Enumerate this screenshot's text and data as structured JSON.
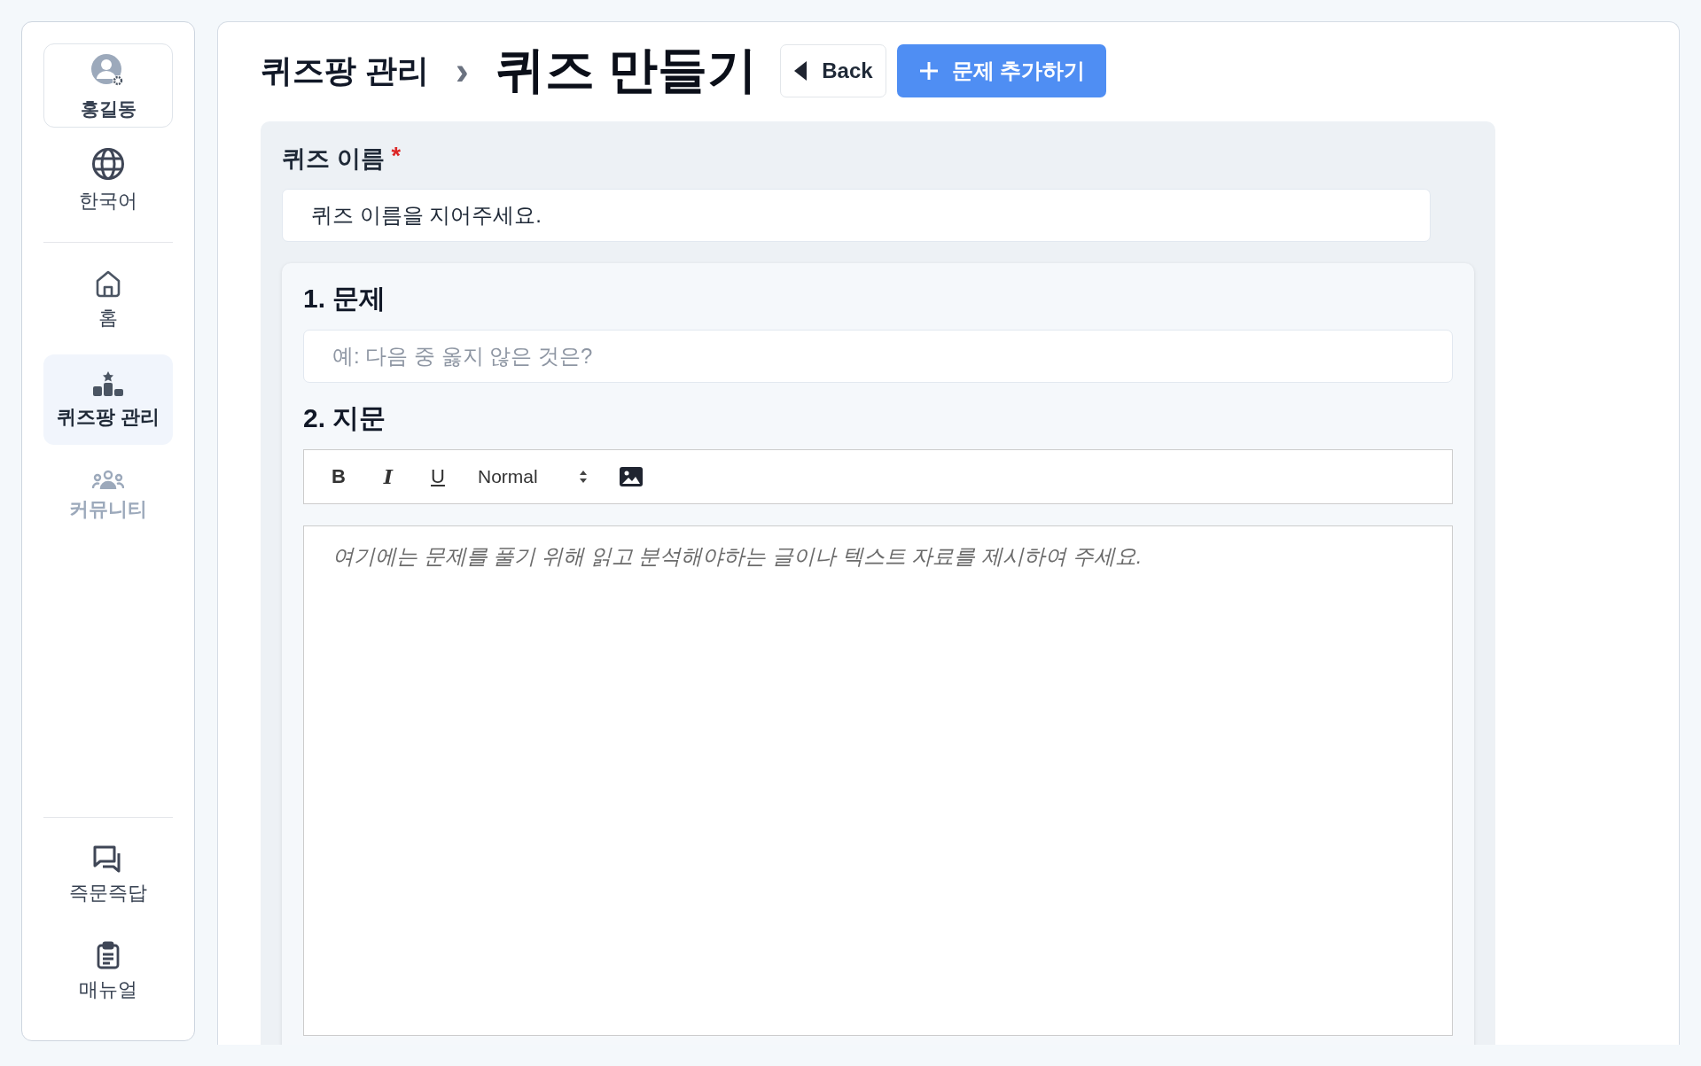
{
  "sidebar": {
    "profile": {
      "name": "홍길동"
    },
    "language": {
      "label": "한국어"
    },
    "nav": [
      {
        "label": "홈",
        "kind": "home",
        "selected": false,
        "disabled": false
      },
      {
        "label": "퀴즈팡 관리",
        "kind": "podium",
        "selected": true,
        "disabled": false
      },
      {
        "label": "커뮤니티",
        "kind": "people",
        "selected": false,
        "disabled": true
      }
    ],
    "footer": [
      {
        "label": "즉문즉답",
        "kind": "chat"
      },
      {
        "label": "매뉴얼",
        "kind": "clipboard"
      }
    ]
  },
  "header": {
    "breadcrumb": "퀴즈팡 관리",
    "separator": "›",
    "title": "퀴즈 만들기",
    "back_button": "Back",
    "add_button": "문제 추가하기"
  },
  "quiz_name": {
    "label": "퀴즈 이름",
    "required_mark": "*",
    "value": "퀴즈 이름을 지어주세요."
  },
  "question": {
    "heading": "1. 문제",
    "placeholder": "예: 다음 중 옳지 않은 것은?"
  },
  "passage": {
    "heading": "2. 지문",
    "toolbar": [
      {
        "kind": "bold",
        "label": "B"
      },
      {
        "kind": "italic",
        "label": "I"
      },
      {
        "kind": "underline",
        "label": "U"
      },
      {
        "kind": "select",
        "label": "Normal"
      },
      {
        "kind": "image"
      }
    ],
    "placeholder": "여기에는 문제를 풀기 위해 읽고 분석해야하는 글이나 텍스트 자료를 제시하여 주세요."
  }
}
